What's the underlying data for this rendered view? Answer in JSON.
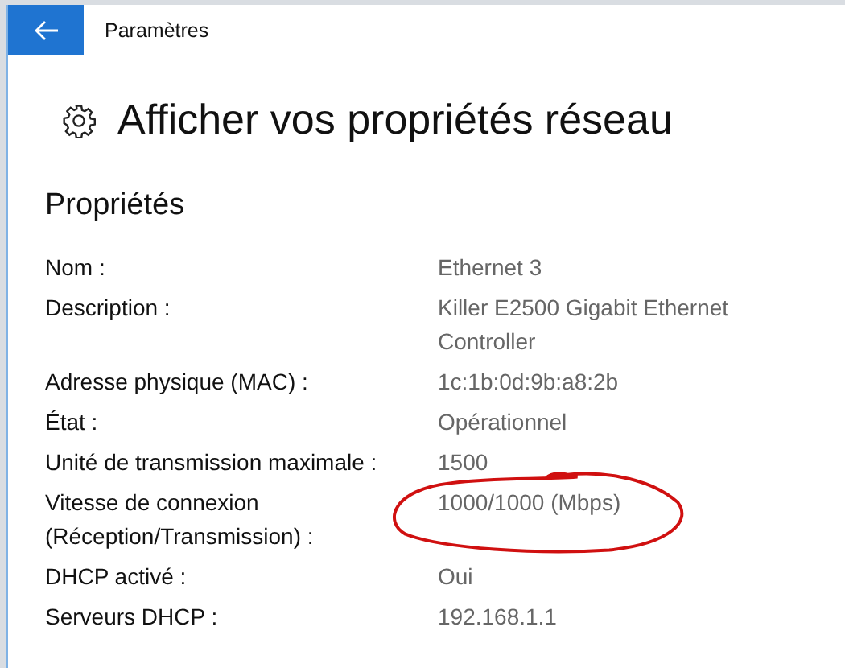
{
  "window": {
    "title": "Paramètres"
  },
  "page": {
    "heading": "Afficher vos propriétés réseau"
  },
  "section": {
    "title": "Propriétés"
  },
  "properties": [
    {
      "label": "Nom :",
      "value": "Ethernet 3",
      "circled": false
    },
    {
      "label": "Description :",
      "value": "Killer E2500 Gigabit Ethernet Controller",
      "circled": false
    },
    {
      "label": "Adresse physique (MAC) :",
      "value": "1c:1b:0d:9b:a8:2b",
      "circled": false
    },
    {
      "label": "État :",
      "value": "Opérationnel",
      "circled": false
    },
    {
      "label": "Unité de transmission maximale :",
      "value": "1500",
      "circled": false
    },
    {
      "label": "Vitesse de connexion (Réception/Transmission) :",
      "value": "1000/1000 (Mbps)",
      "circled": true
    },
    {
      "label": "DHCP activé :",
      "value": "Oui",
      "circled": false
    },
    {
      "label": "Serveurs DHCP :",
      "value": "192.168.1.1",
      "circled": false
    }
  ]
}
